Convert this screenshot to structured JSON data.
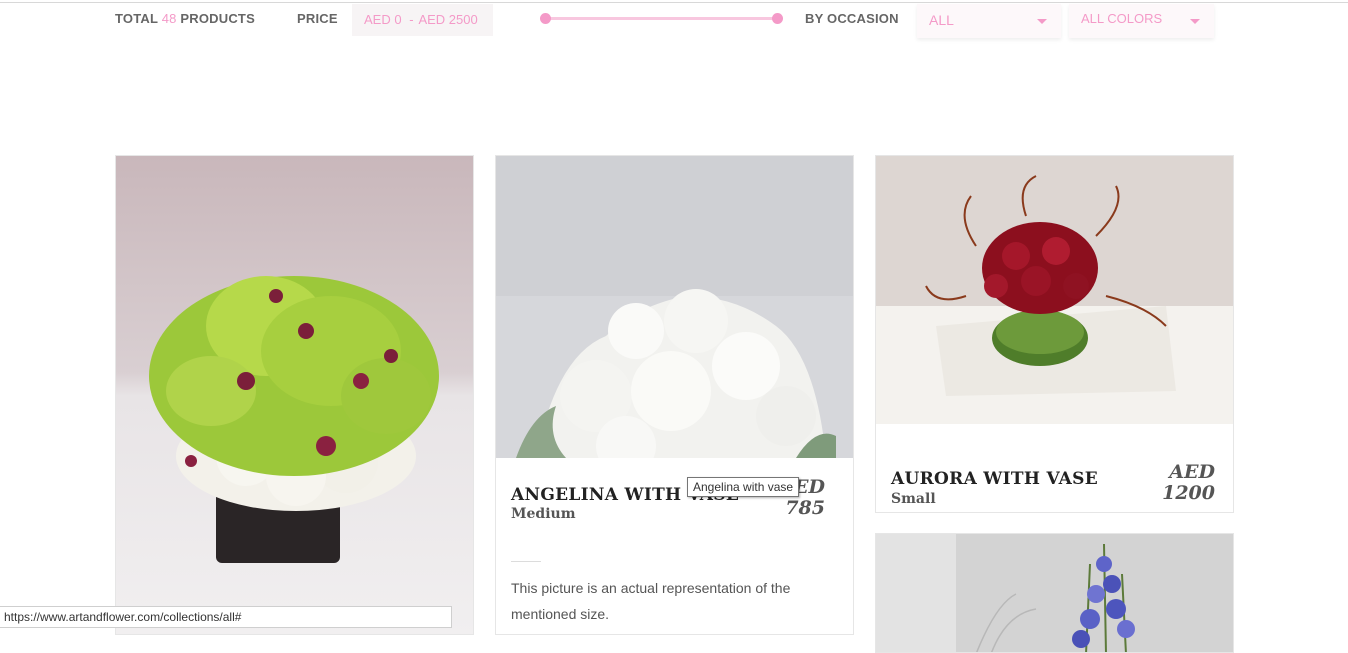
{
  "filters": {
    "total_prefix": "TOTAL",
    "total_count": "48",
    "total_suffix": "PRODUCTS",
    "price_label": "PRICE",
    "price_min": "AED 0",
    "price_sep": "-",
    "price_max": "AED 2500",
    "price_slider_range": [
      0,
      1
    ],
    "occasion_label": "BY OCCASION",
    "occasion_value": "ALL",
    "color_value": "ALL COLORS"
  },
  "products": [
    {
      "name": "",
      "size": "",
      "price_currency": "",
      "price_value": "",
      "description": ""
    },
    {
      "name": "ANGELINA WITH VASE",
      "size": "Medium",
      "price_currency": "AED",
      "price_value": "785",
      "description": "This picture is an actual representation of the mentioned size."
    },
    {
      "name": "AURORA WITH VASE",
      "size": "Small",
      "price_currency": "AED",
      "price_value": "1200",
      "description": ""
    },
    {
      "name": "",
      "size": "",
      "price_currency": "",
      "price_value": "",
      "description": ""
    }
  ],
  "tooltip": "Angelina with vase",
  "status_url": "https://www.artandflower.com/collections/all#",
  "colors": {
    "accent": "#f49ac8",
    "text": "#555555"
  },
  "icons": [
    "chevron-down-icon"
  ]
}
